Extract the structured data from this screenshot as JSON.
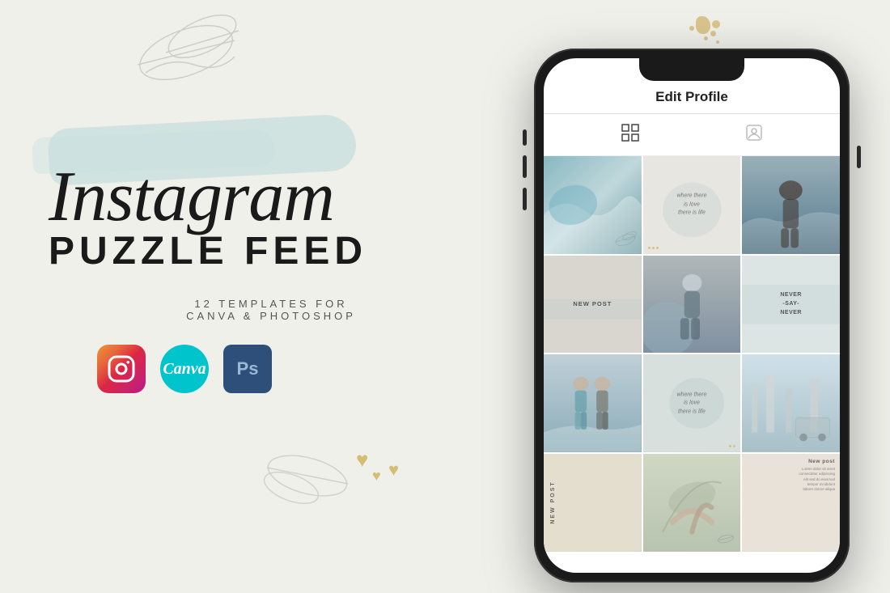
{
  "background_color": "#f0f0eb",
  "left": {
    "title_line1": "Instagram",
    "title_line2": "PUZZLE FEED",
    "subtitle_line1": "12  TEMPLATES  FOR",
    "subtitle_line2": "CANVA & PHOTOSHOP",
    "icons": [
      {
        "id": "instagram",
        "label": "Instagram"
      },
      {
        "id": "canva",
        "label": "Canva"
      },
      {
        "id": "photoshop",
        "label": "Ps"
      }
    ]
  },
  "phone": {
    "header_title": "Edit Profile",
    "tabs": [
      {
        "icon": "grid",
        "active": true
      },
      {
        "icon": "person",
        "active": false
      }
    ],
    "grid": [
      {
        "row": 1,
        "col": 1,
        "type": "photo",
        "bg": "ice-blue"
      },
      {
        "row": 1,
        "col": 2,
        "type": "text",
        "text": "where there\nis love\nthere is life"
      },
      {
        "row": 1,
        "col": 3,
        "type": "photo",
        "bg": "ocean-woman"
      },
      {
        "row": 2,
        "col": 1,
        "type": "text",
        "text": "NEW POST"
      },
      {
        "row": 2,
        "col": 2,
        "type": "photo",
        "bg": "snowy-woman"
      },
      {
        "row": 2,
        "col": 3,
        "type": "text",
        "text": "NEVER\n-SAY-\nNEVER"
      },
      {
        "row": 3,
        "col": 1,
        "type": "photo",
        "bg": "two-women"
      },
      {
        "row": 3,
        "col": 2,
        "type": "text",
        "text": "where there\nis love\nthere is life"
      },
      {
        "row": 3,
        "col": 3,
        "type": "photo",
        "bg": "winter-car"
      },
      {
        "row": 4,
        "col": 1,
        "type": "text",
        "text": "NEW POST"
      },
      {
        "row": 4,
        "col": 2,
        "type": "photo",
        "bg": "hands-leaf"
      },
      {
        "row": 4,
        "col": 3,
        "type": "text-small",
        "text": "New post\nLorem dolor sit amet..."
      }
    ]
  }
}
